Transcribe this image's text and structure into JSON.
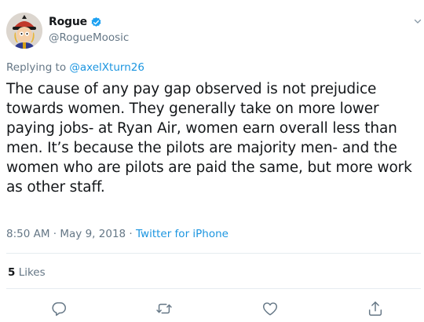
{
  "author": {
    "display_name": "Rogue",
    "handle": "@RogueMoosic",
    "verified": true
  },
  "replying": {
    "prefix": "Replying to",
    "mention": "@axelXturn26"
  },
  "tweet": {
    "text": "The cause of any pay gap observed is not prejudice towards women. They generally take on more lower paying jobs- at Ryan Air, women earn overall less than men. It’s because the pilots are majority men- and the women who are pilots are paid the same, but more work as other staff."
  },
  "meta": {
    "time": "8:50 AM",
    "date": "May 9, 2018",
    "separator": "·",
    "source": "Twitter for iPhone"
  },
  "stats": {
    "likes_count": "5",
    "likes_label": "Likes"
  },
  "icons": {
    "reply": "reply-icon",
    "retweet": "retweet-icon",
    "like": "heart-icon",
    "share": "share-icon",
    "verified": "verified-badge-icon",
    "caret": "chevron-down-icon"
  },
  "colors": {
    "link_blue": "#1b95e0",
    "verified_blue": "#1da1f2",
    "secondary_text": "#657786",
    "primary_text": "#14171a",
    "divider": "#e6ecf0"
  }
}
